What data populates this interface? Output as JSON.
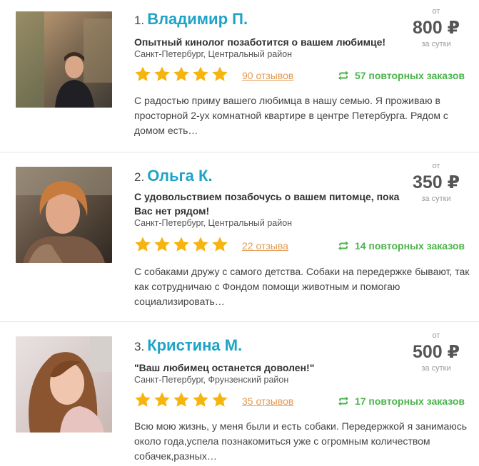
{
  "sitters": [
    {
      "num": "1.",
      "name": "Владимир П.",
      "headline": "Опытный кинолог позаботится о вашем любимце!",
      "location": "Санкт-Петербург, Центральный район",
      "rating": 5,
      "reviews": "90 отзывов",
      "repeat_orders": "57 повторных заказов",
      "description": "С радостью приму вашего любимца в нашу семью. Я проживаю в просторной 2-ух комнатной квартире в центре Петербурга. Рядом с домом есть…",
      "price_from": "от",
      "price": "800 ₽",
      "price_per": "за сутки"
    },
    {
      "num": "2.",
      "name": "Ольга К.",
      "headline": "С удовольствием позабочусь о вашем питомце, пока Вас нет рядом!",
      "location": "Санкт-Петербург, Центральный район",
      "rating": 5,
      "reviews": "22 отзыва",
      "repeat_orders": "14 повторных заказов",
      "description": "С собаками дружу с самого детства. Собаки на передержке бывают, так как сотрудничаю с Фондом помощи животным и помогаю социализировать…",
      "price_from": "от",
      "price": "350 ₽",
      "price_per": "за сутки"
    },
    {
      "num": "3.",
      "name": "Кристина М.",
      "headline": "\"Ваш любимец останется доволен!\"",
      "location": "Санкт-Петербург, Фрунзенский район",
      "rating": 5,
      "reviews": "35 отзывов",
      "repeat_orders": "17 повторных заказов",
      "description": "Всю мою жизнь, у меня были и есть собаки. Передержкой я занимаюсь около года,успела познакомиться уже с огромным количеством собачек,разных…",
      "price_from": "от",
      "price": "500 ₽",
      "price_per": "за сутки"
    }
  ],
  "icons": {
    "star": "star-icon",
    "repeat": "repeat-icon"
  },
  "colors": {
    "name": "#1fa3c7",
    "star": "#f6b40e",
    "reviews": "#e29a52",
    "repeat": "#4bb34b"
  }
}
